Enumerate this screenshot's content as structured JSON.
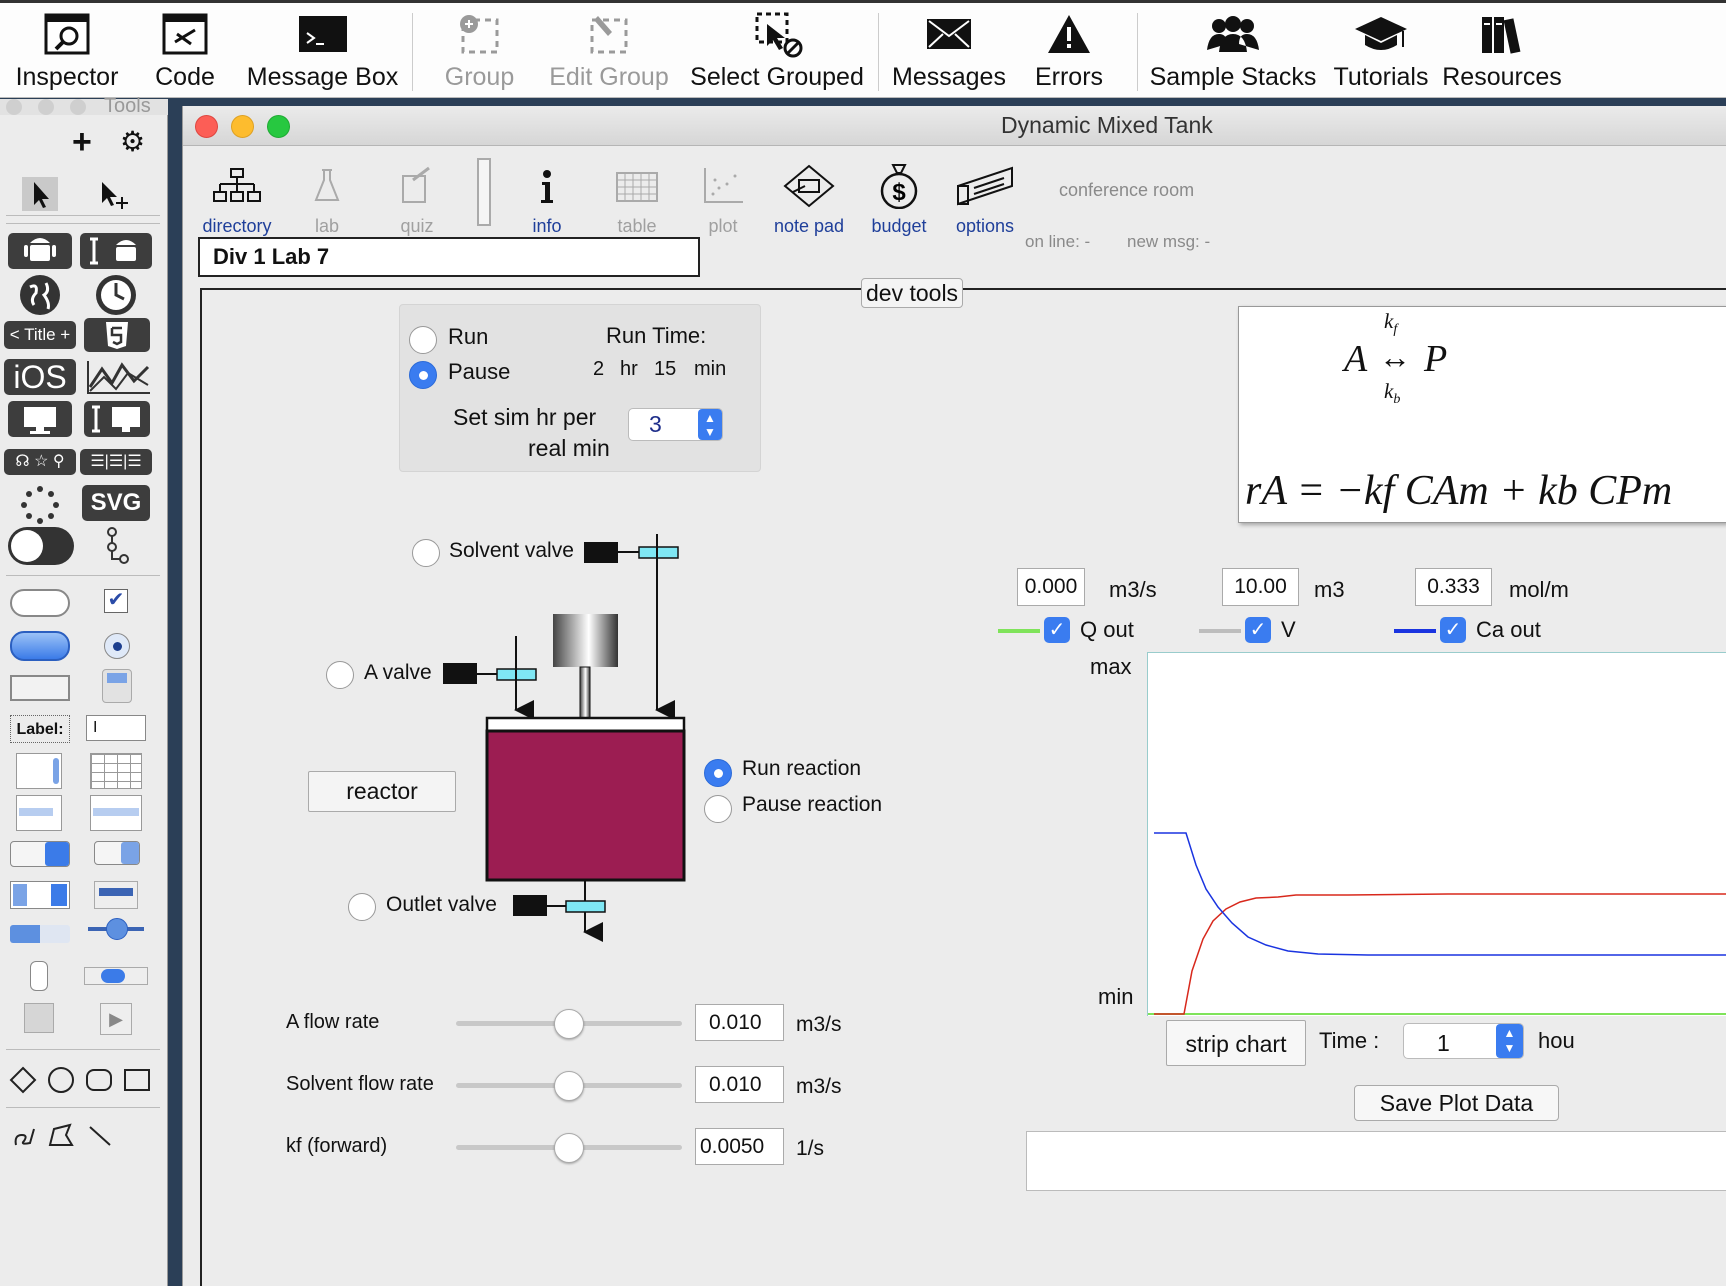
{
  "toolbar": {
    "items": [
      {
        "label": "Inspector",
        "icon": "inspector-icon",
        "enabled": true
      },
      {
        "label": "Code",
        "icon": "code-icon",
        "enabled": true
      },
      {
        "label": "Message Box",
        "icon": "message-box-icon",
        "enabled": true
      },
      {
        "label": "Group",
        "icon": "group-icon",
        "enabled": false
      },
      {
        "label": "Edit Group",
        "icon": "edit-group-icon",
        "enabled": false
      },
      {
        "label": "Select Grouped",
        "icon": "select-grouped-icon",
        "enabled": true
      },
      {
        "label": "Messages",
        "icon": "messages-icon",
        "enabled": true
      },
      {
        "label": "Errors",
        "icon": "errors-icon",
        "enabled": true
      },
      {
        "label": "Sample Stacks",
        "icon": "sample-stacks-icon",
        "enabled": true
      },
      {
        "label": "Tutorials",
        "icon": "tutorials-icon",
        "enabled": true
      },
      {
        "label": "Resources",
        "icon": "resources-icon",
        "enabled": true
      }
    ]
  },
  "tools": {
    "title": "Tools",
    "title_widget": "< Title +",
    "svg_label": "SVG",
    "ios_label": "iOS",
    "label_widget": "Label:"
  },
  "window": {
    "title": "Dynamic Mixed Tank"
  },
  "nav": {
    "items": [
      {
        "label": "directory",
        "enabled": true
      },
      {
        "label": "lab",
        "enabled": false
      },
      {
        "label": "quiz",
        "enabled": false
      },
      {
        "label": "info",
        "enabled": true
      },
      {
        "label": "table",
        "enabled": false
      },
      {
        "label": "plot",
        "enabled": false
      },
      {
        "label": "note pad",
        "enabled": true
      },
      {
        "label": "budget",
        "enabled": true
      },
      {
        "label": "options",
        "enabled": true
      }
    ],
    "conference": "conference room",
    "online": "on line: -",
    "newmsg": "new msg: -"
  },
  "lab_name": "Div 1 Lab 7",
  "dev_tools": "dev tools",
  "sim": {
    "run": "Run",
    "pause": "Pause",
    "selected": "Pause",
    "run_time_label": "Run Time:",
    "hr_val": "2",
    "hr_unit": "hr",
    "min_val": "15",
    "min_unit": "min",
    "rate_label_1": "Set sim hr per",
    "rate_label_2": "real min",
    "rate_value": "3"
  },
  "valves": {
    "solvent": "Solvent valve",
    "a": "A valve",
    "outlet": "Outlet valve"
  },
  "reactor_button": "reactor",
  "reaction": {
    "run": "Run reaction",
    "pause": "Pause reaction",
    "selected": "Run reaction"
  },
  "equation": {
    "kf": "k",
    "kf_sub": "f",
    "kb": "k",
    "kb_sub": "b",
    "A": "A",
    "P": "P",
    "rate_expr": "rA = −kf CAm + kb CPm"
  },
  "readouts": [
    {
      "value": "0.000",
      "unit": "m3/s",
      "legend": "Q out",
      "color": "#7fe35a",
      "checked": true
    },
    {
      "value": "10.00",
      "unit": "m3",
      "legend": "V",
      "color": "#bdbdbd",
      "checked": true
    },
    {
      "value": "0.333",
      "unit": "mol/m",
      "legend": "Ca out",
      "color": "#1a34e0",
      "checked": true
    }
  ],
  "plot": {
    "max_label": "max",
    "min_label": "min",
    "strip_chart": "strip chart",
    "time_label": "Time :",
    "time_value": "1",
    "time_unit": "hou",
    "save": "Save Plot Data"
  },
  "controls": [
    {
      "label": "A flow rate",
      "value": "0.010",
      "unit": "m3/s",
      "position": 0.5
    },
    {
      "label": "Solvent flow rate",
      "value": "0.010",
      "unit": "m3/s",
      "position": 0.5
    },
    {
      "label": "kf (forward)",
      "value": "0.0050",
      "unit": "1/s",
      "position": 0.5
    }
  ]
}
